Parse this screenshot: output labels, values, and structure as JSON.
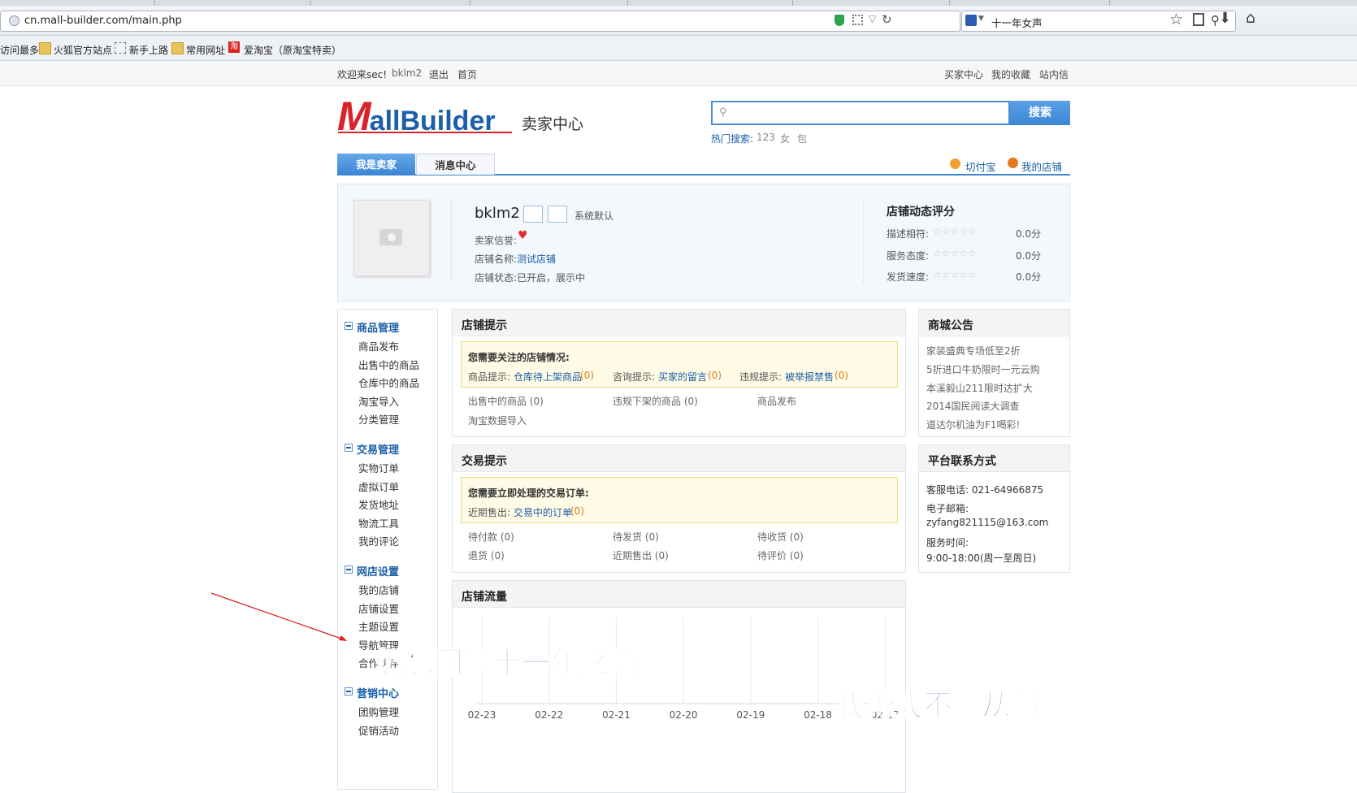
{
  "browser": {
    "url": "cn.mall-builder.com/main.php",
    "search_value": "十一年女声",
    "bookmarks": [
      "访问最多",
      "火狐官方站点",
      "新手上路",
      "常用网址",
      "爱淘宝（原淘宝特卖）"
    ],
    "taobao_badge": "淘"
  },
  "topbar": {
    "welcome": "欢迎来sec!",
    "username": "bklm2",
    "logout": "退出",
    "home": "首页",
    "buyer_center": "买家中心",
    "favorites": "我的收藏",
    "messages": "站内信"
  },
  "header": {
    "logo_m": "M",
    "logo_text": "allBuilder",
    "subtitle": "卖家中心",
    "search_button": "搜索",
    "hot_label": "热门搜索:",
    "hot_terms": [
      "123",
      "女",
      "包"
    ]
  },
  "tabs": {
    "seller": "我是卖家",
    "message_center": "消息中心",
    "pay": "切付宝",
    "my_shop": "我的店铺"
  },
  "profile": {
    "name": "bklm2",
    "default_tag": "系统默认",
    "credit_label": "卖家信誉:",
    "shop_name_label": "店铺名称:",
    "shop_name": "测试店铺",
    "status_label": "店铺状态:",
    "status": "已开启，展示中",
    "rating_title": "店铺动态评分",
    "ratings": [
      {
        "label": "描述相符:",
        "score": "0.0分"
      },
      {
        "label": "服务态度:",
        "score": "0.0分"
      },
      {
        "label": "发货速度:",
        "score": "0.0分"
      }
    ]
  },
  "sidebar": {
    "sections": [
      {
        "title": "商品管理",
        "items": [
          "商品发布",
          "出售中的商品",
          "仓库中的商品",
          "淘宝导入",
          "分类管理"
        ]
      },
      {
        "title": "交易管理",
        "items": [
          "实物订单",
          "虚拟订单",
          "发货地址",
          "物流工具",
          "我的评论"
        ]
      },
      {
        "title": "网店设置",
        "items": [
          "我的店铺",
          "店铺设置",
          "主题设置",
          "导航管理",
          "合作伙伴"
        ]
      },
      {
        "title": "营销中心",
        "items": [
          "团购管理",
          "促销活动"
        ]
      }
    ]
  },
  "shop_tips": {
    "title": "店铺提示",
    "notice_title": "您需要关注的店铺情况:",
    "goods_label": "商品提示:",
    "goods_link": "仓库待上架商品",
    "goods_count": "(0)",
    "consult_label": "咨询提示:",
    "consult_link": "买家的留言",
    "consult_count": "(0)",
    "violation_label": "违规提示:",
    "violation_link": "被举报禁售",
    "violation_count": "(0)",
    "row1": [
      "出售中的商品 (0)",
      "违规下架的商品 (0)",
      "商品发布"
    ],
    "row2": [
      "淘宝数据导入"
    ]
  },
  "trade_tips": {
    "title": "交易提示",
    "notice_title": "您需要立即处理的交易订单:",
    "recent_label": "近期售出:",
    "recent_link": "交易中的订单",
    "recent_count": "(0)",
    "row1": [
      "待付款 (0)",
      "待发货 (0)",
      "待收货 (0)"
    ],
    "row2": [
      "退货 (0)",
      "近期售出 (0)",
      "待评价 (0)"
    ]
  },
  "traffic": {
    "title": "店铺流量"
  },
  "chart_data": {
    "type": "line",
    "categories": [
      "02-23",
      "02-22",
      "02-21",
      "02-20",
      "02-19",
      "02-18",
      "02-17"
    ],
    "series": [],
    "title": "店铺流量",
    "grid": true
  },
  "announcements": {
    "title": "商城公告",
    "items": [
      "家装盛典专场低至2折",
      "5折进口牛奶限时一元云购",
      "本溪毅山211限时达扩大",
      "2014国民阅读大调查",
      "道达尔机油为F1喝彩!"
    ]
  },
  "contact": {
    "title": "平台联系方式",
    "phone": "客服电话: 021-64966875",
    "email_label": "电子邮箱:",
    "email": "zyfang821115@163.com",
    "hours_label": "服务时间:",
    "hours": "9:00-18:00(周一至周日)"
  },
  "subtitles": {
    "line1": "仍想回到十一年之前",
    "line2": "我再找不到从前"
  },
  "colors": {
    "brand_red": "#d8232a",
    "brand_blue": "#1a5fa8",
    "tab_active": "#3d86d4",
    "subtitle_fill": "#1e63b5"
  }
}
